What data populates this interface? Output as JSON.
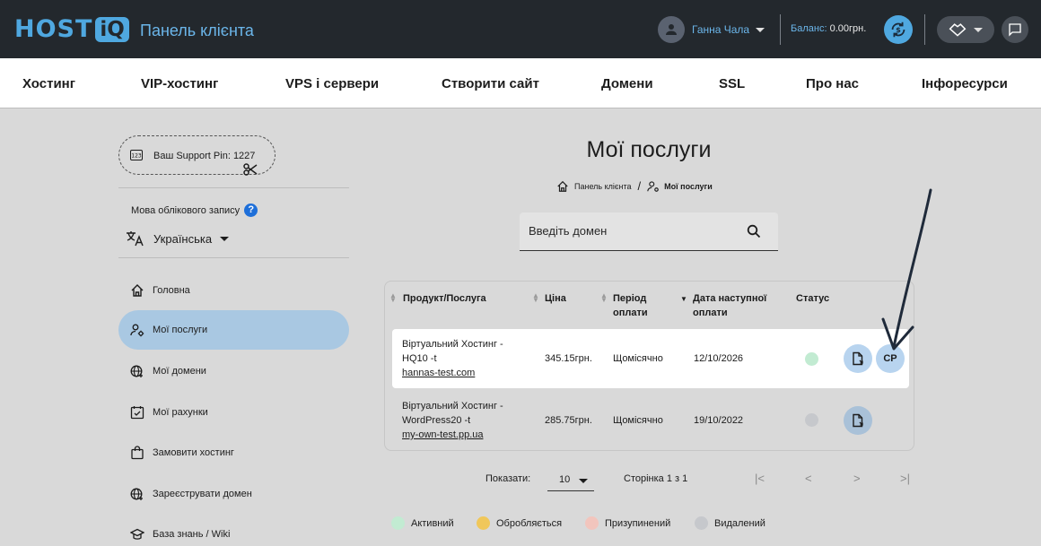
{
  "header": {
    "logo_host": "HOST",
    "logo_iq": "iQ",
    "panel_title": "Панель клієнта",
    "user_name": "Ганна Чала",
    "balance_label": "Баланс:",
    "balance_value": "0.00грн."
  },
  "nav": {
    "items": [
      "Хостинг",
      "VIP-хостинг",
      "VPS і сервери",
      "Створити сайт",
      "Домени",
      "SSL",
      "Про нас",
      "Інфоресурси"
    ]
  },
  "sidebar": {
    "support_pin_label": "Ваш Support Pin:",
    "support_pin_value": "1227",
    "language_label": "Мова облікового запису",
    "language_help": "?",
    "language_value": "Українська",
    "items": [
      {
        "label": "Головна",
        "icon": "home-icon"
      },
      {
        "label": "Мої послуги",
        "icon": "user-settings-icon"
      },
      {
        "label": "Мої домени",
        "icon": "globe-icon"
      },
      {
        "label": "Мої рахунки",
        "icon": "calendar-check-icon"
      },
      {
        "label": "Замовити хостинг",
        "icon": "shopping-bag-icon"
      },
      {
        "label": "Зареєструвати домен",
        "icon": "globe-add-icon"
      },
      {
        "label": "База знань / Wiki",
        "icon": "graduation-cap-icon"
      }
    ]
  },
  "main": {
    "title": "Мої послуги",
    "breadcrumb_home": "Панель клієнта",
    "breadcrumb_sep": "/",
    "breadcrumb_current": "Мої послуги",
    "search_placeholder": "Введіть домен"
  },
  "table": {
    "headers": {
      "product": "Продукт/Послуга",
      "price": "Ціна",
      "period_1": "Період",
      "period_2": "оплати",
      "next_date_1": "Дата наступної",
      "next_date_2": "оплати",
      "status": "Статус"
    },
    "rows": [
      {
        "product_1": "Віртуальний Хостинг -",
        "product_2": "HQ10 -t",
        "domain": "hannas-test.com",
        "price": "345.15грн.",
        "period": "Щомісячно",
        "next_date": "12/10/2026",
        "status_color": "#c2ebd2",
        "cp_label": "CP"
      },
      {
        "product_1": "Віртуальний Хостинг -",
        "product_2": "WordPress20 -t",
        "domain": "my-own-test.pp.ua",
        "price": "285.75грн.",
        "period": "Щомісячно",
        "next_date": "19/10/2022",
        "status_color": "#c6c8cc"
      }
    ]
  },
  "pagination": {
    "show_label": "Показати:",
    "per_page": "10",
    "page_info": "Сторінка 1 з 1",
    "first": "|<",
    "prev": "<",
    "next": ">",
    "last": ">|"
  },
  "legend": [
    {
      "label": "Активний",
      "color": "#c2ebd2"
    },
    {
      "label": "Обробляється",
      "color": "#f0c75a"
    },
    {
      "label": "Призупинений",
      "color": "#f2c5bd"
    },
    {
      "label": "Видалений",
      "color": "#c6c8cc"
    }
  ]
}
